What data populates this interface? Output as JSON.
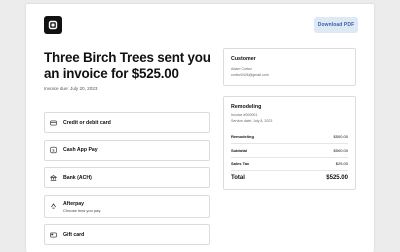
{
  "header": {
    "download_label": "Download PDF"
  },
  "invoice": {
    "title": "Three Birch Trees sent you an invoice for $525.00",
    "due_label": "Invoice due: July 20, 2023"
  },
  "payment_methods": [
    {
      "label": "Credit or debit card",
      "icon": "credit-card-icon"
    },
    {
      "label": "Cash App Pay",
      "icon": "cash-app-icon"
    },
    {
      "label": "Bank (ACH)",
      "icon": "bank-icon"
    },
    {
      "label": "Afterpay",
      "sublabel": "Choose how you pay.",
      "icon": "afterpay-icon"
    },
    {
      "label": "Gift card",
      "icon": "gift-card-icon"
    }
  ],
  "customer": {
    "heading": "Customer",
    "name": "Adam Cortez",
    "email": "cortez0426@gmail.com"
  },
  "remodeling": {
    "heading": "Remodeling",
    "invoice_number": "Invoice #000001",
    "service_date": "Service date: July 8, 2023",
    "line_item": {
      "label": "Remodeling",
      "value": "$500.00"
    },
    "subtotal": {
      "label": "Subtotal",
      "value": "$500.00"
    },
    "sales_tax": {
      "label": "Sales Tax",
      "value": "$25.00"
    },
    "total": {
      "label": "Total",
      "value": "$525.00"
    }
  },
  "colors": {
    "background": "#ececec",
    "download_button_bg": "#dfe8f5",
    "download_button_text": "#3a62a8",
    "logo": "#111111"
  }
}
